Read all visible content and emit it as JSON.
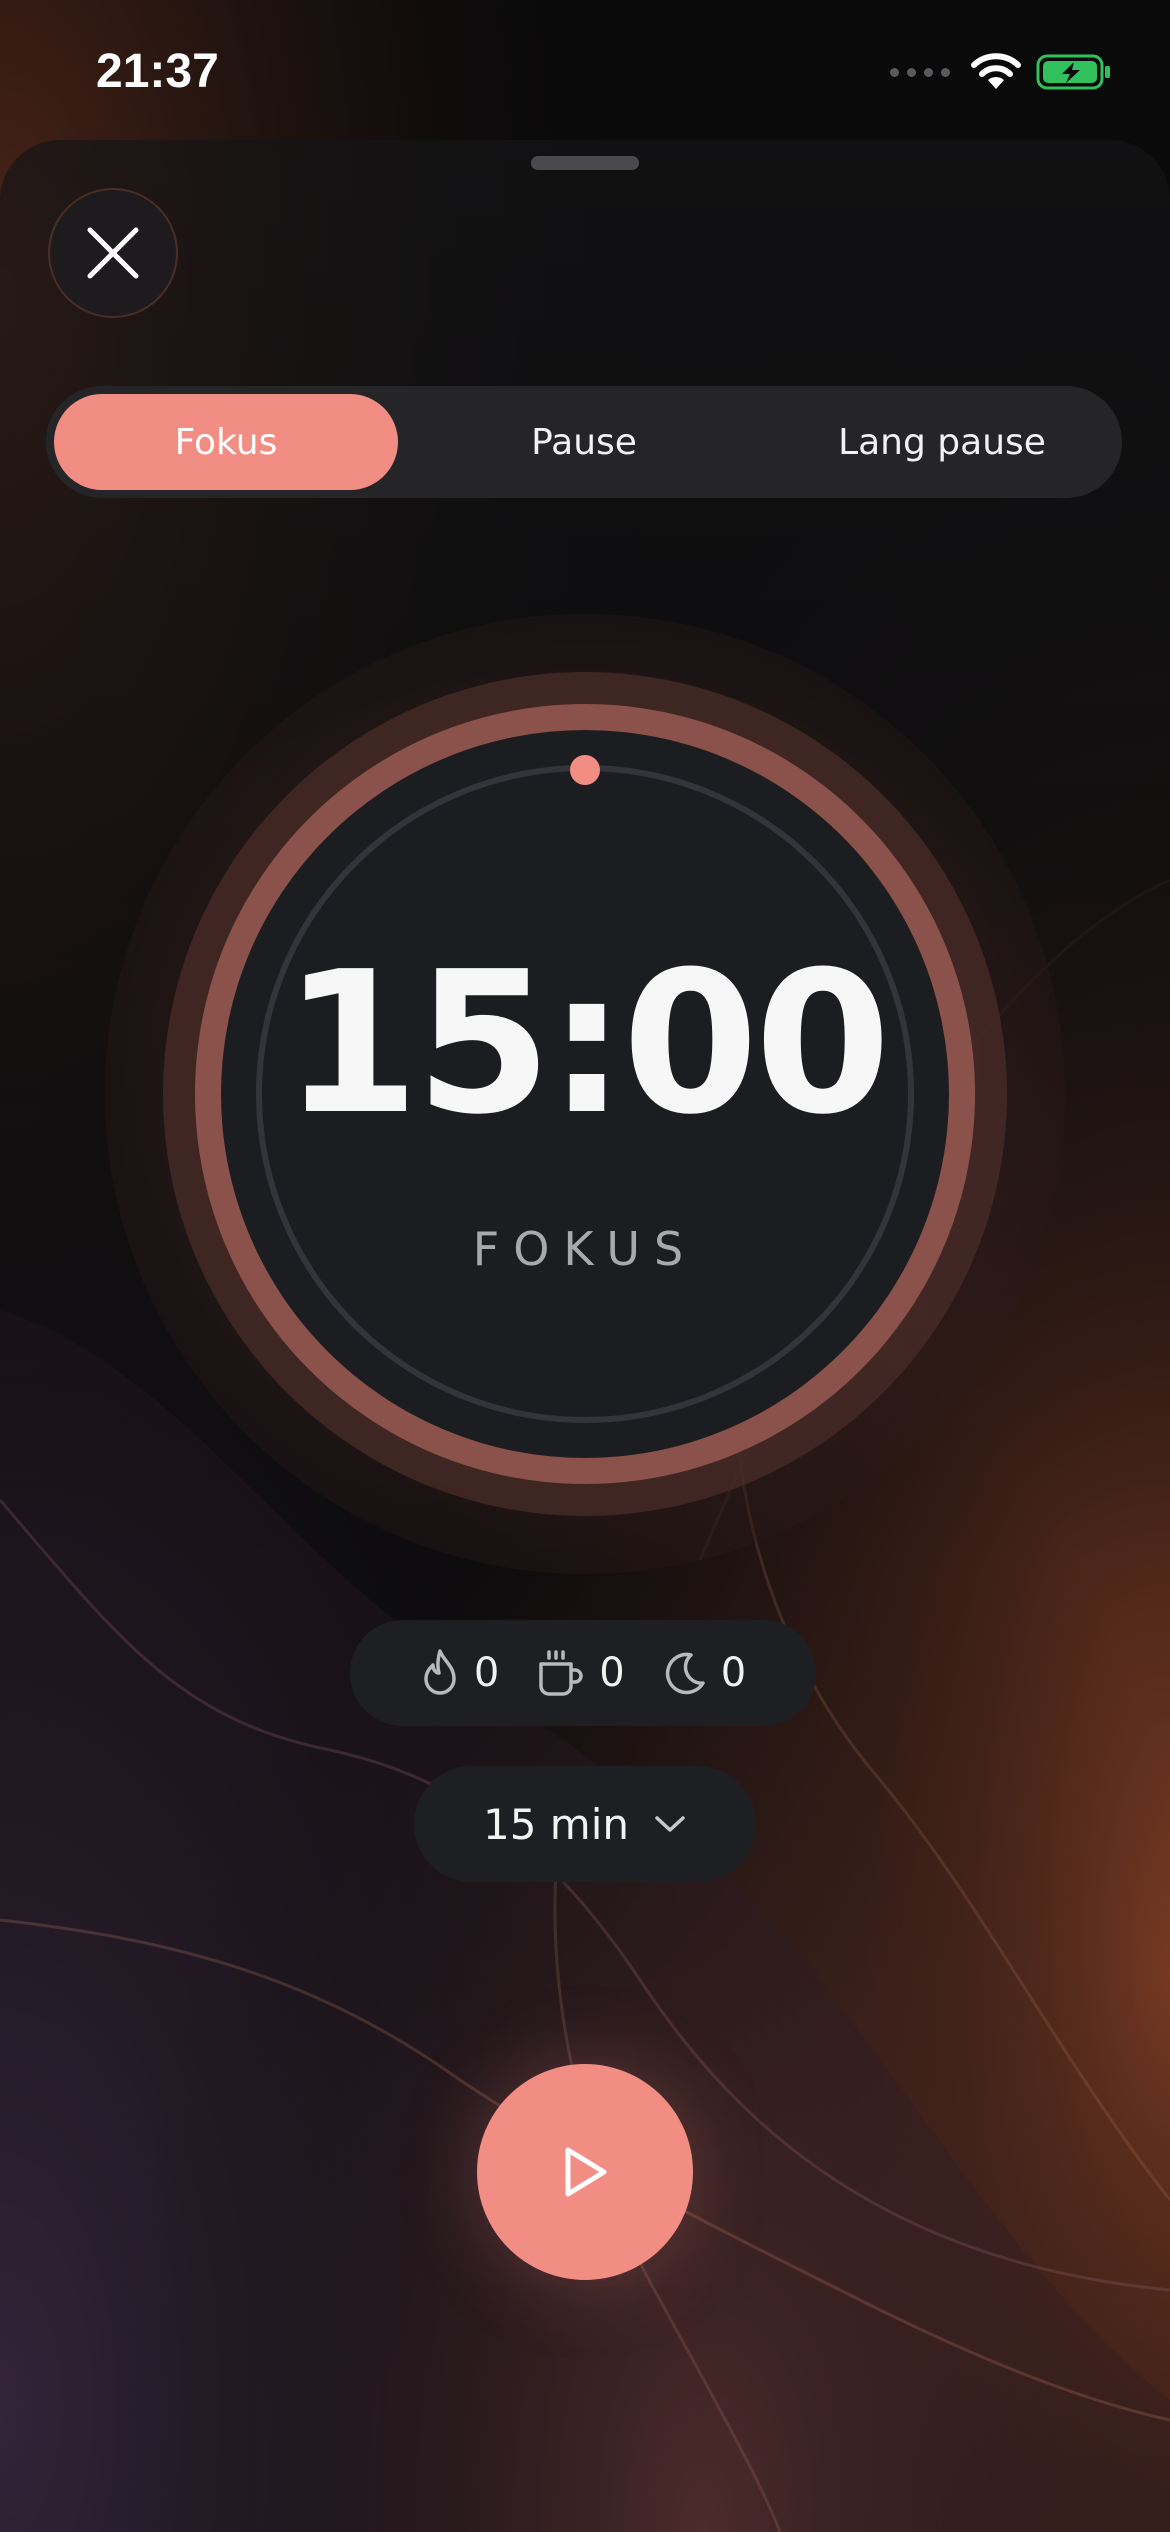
{
  "status_bar": {
    "time": "21:37",
    "icons": [
      "cellular-signal-icon",
      "wifi-icon",
      "battery-charging-icon"
    ]
  },
  "sheet": {
    "close_icon": "close-icon"
  },
  "mode_tabs": [
    {
      "label": "Fokus",
      "selected": true
    },
    {
      "label": "Pause",
      "selected": false
    },
    {
      "label": "Lang pause",
      "selected": false
    }
  ],
  "timer": {
    "time": "15:00",
    "mode_label": "FOKUS",
    "progress": 0.0
  },
  "counters": [
    {
      "icon": "flame-icon",
      "value": "0"
    },
    {
      "icon": "coffee-cup-icon",
      "value": "0"
    },
    {
      "icon": "moon-icon",
      "value": "0"
    }
  ],
  "duration": {
    "value": "15 min",
    "icon": "chevron-down-icon"
  },
  "play_button": {
    "icon": "play-icon"
  },
  "colors": {
    "accent": "#f28d83",
    "surface": "#1e1f22",
    "ring": "#7a4a44",
    "background": "#0a0a0b"
  }
}
